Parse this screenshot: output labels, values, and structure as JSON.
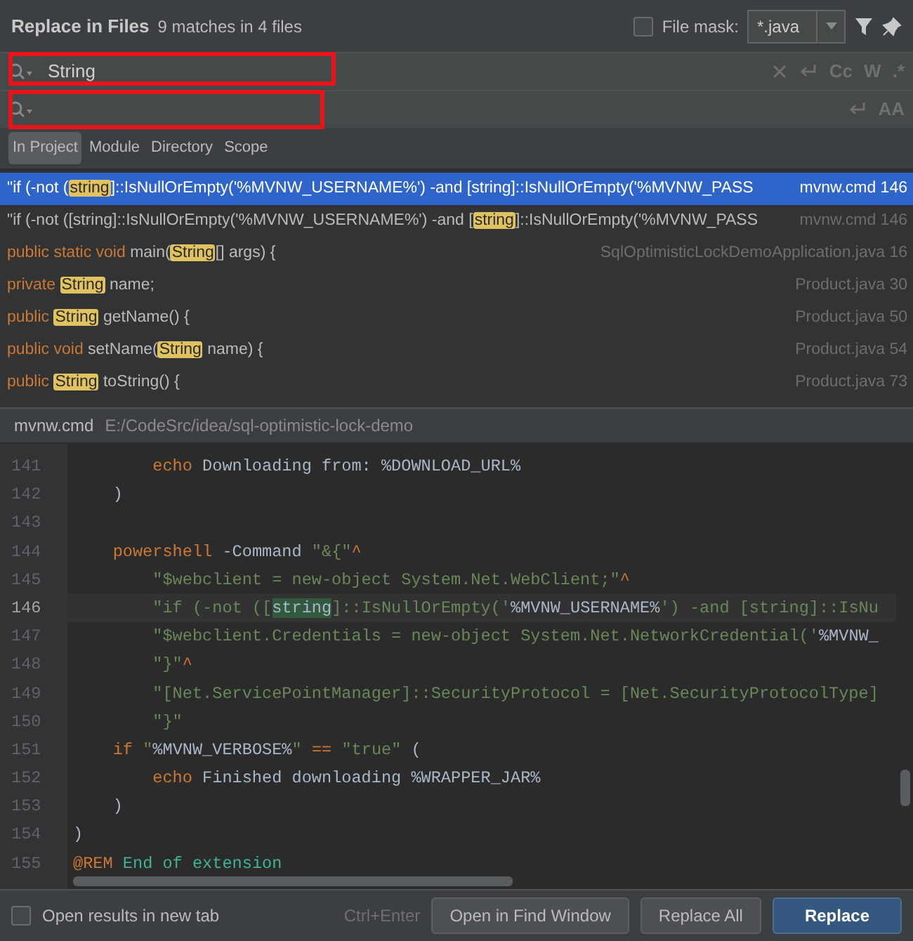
{
  "header": {
    "title": "Replace in Files",
    "summary": "9 matches in 4 files",
    "file_mask": {
      "label": "File mask:",
      "checked": false,
      "value": "*.java"
    }
  },
  "search": {
    "value": "String",
    "marked": true,
    "toggles": [
      "Cc",
      "W",
      ".*"
    ]
  },
  "replace": {
    "marked": true,
    "toggles": [
      "AA"
    ]
  },
  "scopes": [
    {
      "label": "In Project",
      "selected": true
    },
    {
      "label": "Module",
      "selected": false
    },
    {
      "label": "Directory",
      "selected": false
    },
    {
      "label": "Scope",
      "selected": false
    }
  ],
  "results": [
    {
      "selected": true,
      "file": "mvnw.cmd",
      "line": "146",
      "tokens": [
        {
          "kind": "plain",
          "text": "\"if (-not ("
        },
        {
          "kind": "match",
          "text": "string"
        },
        {
          "kind": "plain",
          "text": "]::IsNullOrEmpty('%MVNW_USERNAME%') -and [string]::IsNullOrEmpty('%MVNW_PASS"
        }
      ]
    },
    {
      "selected": false,
      "file": "mvnw.cmd",
      "line": "146",
      "tokens": [
        {
          "kind": "plain",
          "text": "\"if (-not ([string]::IsNullOrEmpty('%MVNW_USERNAME%') -and ["
        },
        {
          "kind": "match",
          "text": "string"
        },
        {
          "kind": "plain",
          "text": "]::IsNullOrEmpty('%MVNW_PASS"
        }
      ]
    },
    {
      "selected": false,
      "file": "SqlOptimisticLockDemoApplication.java",
      "line": "16",
      "tokens": [
        {
          "kind": "keyword",
          "text": "public static void"
        },
        {
          "kind": "plain",
          "text": " main("
        },
        {
          "kind": "match",
          "text": "String"
        },
        {
          "kind": "plain",
          "text": "[] args) {"
        }
      ]
    },
    {
      "selected": false,
      "file": "Product.java",
      "line": "30",
      "tokens": [
        {
          "kind": "keyword",
          "text": "private "
        },
        {
          "kind": "match",
          "text": "String"
        },
        {
          "kind": "plain",
          "text": " name;"
        }
      ]
    },
    {
      "selected": false,
      "file": "Product.java",
      "line": "50",
      "tokens": [
        {
          "kind": "keyword",
          "text": "public "
        },
        {
          "kind": "match",
          "text": "String"
        },
        {
          "kind": "plain",
          "text": " getName() {"
        }
      ]
    },
    {
      "selected": false,
      "file": "Product.java",
      "line": "54",
      "tokens": [
        {
          "kind": "keyword",
          "text": "public void"
        },
        {
          "kind": "plain",
          "text": " setName("
        },
        {
          "kind": "match",
          "text": "String"
        },
        {
          "kind": "plain",
          "text": " name) {"
        }
      ]
    },
    {
      "selected": false,
      "file": "Product.java",
      "line": "73",
      "tokens": [
        {
          "kind": "keyword",
          "text": "public "
        },
        {
          "kind": "match",
          "text": "String"
        },
        {
          "kind": "plain",
          "text": " toString() {"
        }
      ]
    }
  ],
  "preview": {
    "file": "mvnw.cmd",
    "path": "E:/CodeSrc/idea/sql-optimistic-lock-demo",
    "lines": [
      {
        "number": "141",
        "current": false,
        "tokens": [
          {
            "kind": "keyword",
            "text": "        echo"
          },
          {
            "kind": "plain",
            "text": " Downloading from: %DOWNLOAD_URL%"
          }
        ]
      },
      {
        "number": "142",
        "current": false,
        "tokens": [
          {
            "kind": "plain",
            "text": "    )"
          }
        ]
      },
      {
        "number": "143",
        "current": false
      },
      {
        "number": "144",
        "current": false,
        "tokens": [
          {
            "kind": "keyword",
            "text": "    powershell"
          },
          {
            "kind": "plain",
            "text": " -Command "
          },
          {
            "kind": "string",
            "text": "\"&{\""
          },
          {
            "kind": "keyword",
            "text": "^"
          }
        ]
      },
      {
        "number": "145",
        "current": false,
        "tokens": [
          {
            "kind": "string",
            "text": "        \"$webclient = new-object System.Net.WebClient;\""
          },
          {
            "kind": "keyword",
            "text": "^"
          }
        ]
      },
      {
        "number": "146",
        "current": true,
        "tokens": [
          {
            "kind": "string",
            "text": "        \"if (-not (["
          },
          {
            "kind": "match",
            "text": "string"
          },
          {
            "kind": "string",
            "text": "]::IsNullOrEmpty('"
          },
          {
            "kind": "plain",
            "text": "%MVNW_USERNAME%"
          },
          {
            "kind": "string",
            "text": "') -and [string]::IsNu"
          }
        ]
      },
      {
        "number": "147",
        "current": false,
        "tokens": [
          {
            "kind": "string",
            "text": "        \"$webclient.Credentials = new-object System.Net.NetworkCredential('"
          },
          {
            "kind": "plain",
            "text": "%MVNW_"
          }
        ]
      },
      {
        "number": "148",
        "current": false,
        "tokens": [
          {
            "kind": "string",
            "text": "        \"}\""
          },
          {
            "kind": "keyword",
            "text": "^"
          }
        ]
      },
      {
        "number": "149",
        "current": false,
        "tokens": [
          {
            "kind": "string",
            "text": "        \"[Net.ServicePointManager]::SecurityProtocol = [Net.SecurityProtocolType]"
          }
        ]
      },
      {
        "number": "150",
        "current": false,
        "tokens": [
          {
            "kind": "string",
            "text": "        \"}\""
          }
        ]
      },
      {
        "number": "151",
        "current": false,
        "tokens": [
          {
            "kind": "keyword",
            "text": "    if"
          },
          {
            "kind": "string",
            "text": " \""
          },
          {
            "kind": "plain",
            "text": "%MVNW_VERBOSE%"
          },
          {
            "kind": "string",
            "text": "\""
          },
          {
            "kind": "keyword",
            "text": " == "
          },
          {
            "kind": "string",
            "text": "\"true\""
          },
          {
            "kind": "plain",
            "text": " ("
          }
        ]
      },
      {
        "number": "152",
        "current": false,
        "tokens": [
          {
            "kind": "keyword",
            "text": "        echo"
          },
          {
            "kind": "plain",
            "text": " Finished downloading %WRAPPER_JAR%"
          }
        ]
      },
      {
        "number": "153",
        "current": false,
        "tokens": [
          {
            "kind": "plain",
            "text": "    )"
          }
        ]
      },
      {
        "number": "154",
        "current": false,
        "tokens": [
          {
            "kind": "plain",
            "text": ")"
          }
        ]
      },
      {
        "number": "155",
        "current": false,
        "tokens": [
          {
            "kind": "keyword",
            "text": "@REM"
          },
          {
            "kind": "comment",
            "text": " End of extension"
          }
        ]
      }
    ]
  },
  "footer": {
    "new_tab": {
      "label": "Open results in new tab",
      "checked": false
    },
    "shortcut": "Ctrl+Enter",
    "buttons": [
      {
        "label": "Open in Find Window",
        "primary": false
      },
      {
        "label": "Replace All",
        "primary": false
      },
      {
        "label": "Replace",
        "primary": true
      }
    ]
  }
}
